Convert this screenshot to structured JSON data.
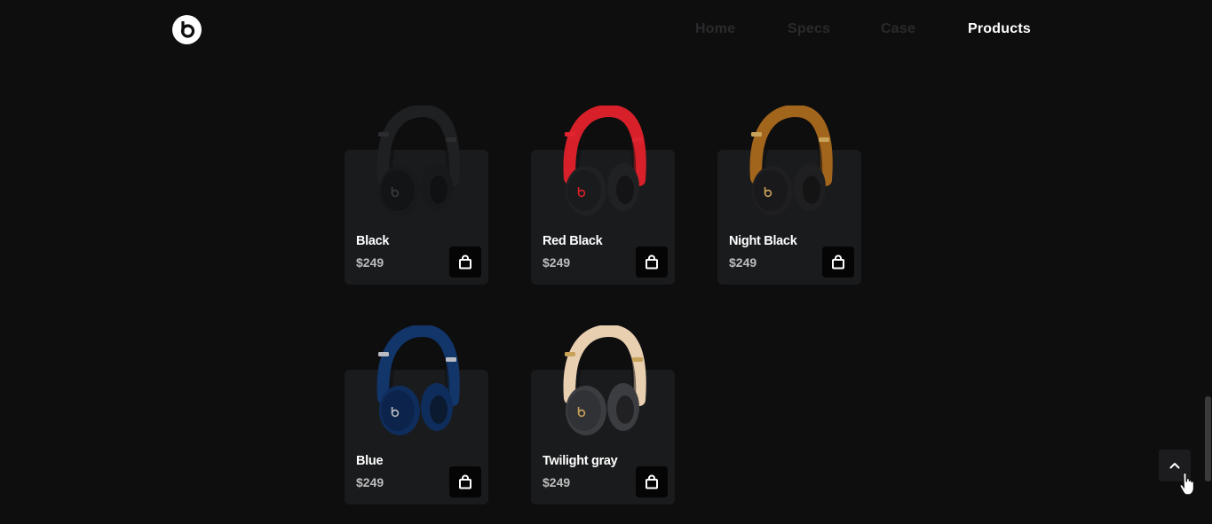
{
  "header": {
    "logo_icon": "beats-logo-icon",
    "nav": [
      "Home",
      "Specs",
      "Case",
      "Products"
    ],
    "active_nav": "Products"
  },
  "products": [
    {
      "name": "Black",
      "price": "$249",
      "colors": {
        "band": "#1f2022",
        "accent": "#2b2c2f",
        "cup": "#18191b",
        "logo": "#3a3a3d"
      }
    },
    {
      "name": "Red Black",
      "price": "$249",
      "colors": {
        "band": "#d8202a",
        "accent": "#e02530",
        "cup": "#202123",
        "logo": "#d8202a"
      }
    },
    {
      "name": "Night Black",
      "price": "$249",
      "colors": {
        "band": "#a2651c",
        "accent": "#c9a35a",
        "cup": "#1f1f21",
        "logo": "#c9a35a"
      }
    },
    {
      "name": "Blue",
      "price": "$249",
      "colors": {
        "band": "#12356a",
        "accent": "#b9bcc2",
        "cup": "#0f2d5c",
        "logo": "#b9bcc2"
      }
    },
    {
      "name": "Twilight gray",
      "price": "$249",
      "colors": {
        "band": "#e8cfb0",
        "accent": "#c9a35a",
        "cup": "#3c3d41",
        "logo": "#c9a35a"
      }
    }
  ],
  "cart_icon": "shopping-bag-icon",
  "scroll_top_icon": "chevron-up-icon"
}
